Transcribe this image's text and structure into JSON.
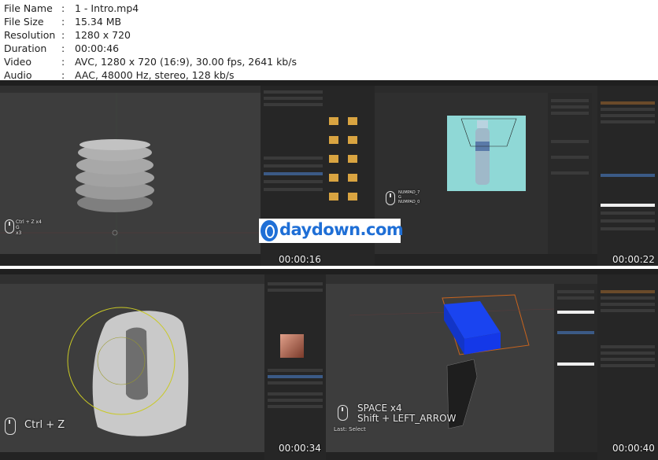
{
  "media_info": [
    {
      "key": "File Name",
      "sep": ":",
      "value": "1 - Intro.mp4"
    },
    {
      "key": "File Size",
      "sep": ":",
      "value": "15.34 MB"
    },
    {
      "key": "Resolution",
      "sep": ":",
      "value": "1280 x 720"
    },
    {
      "key": "Duration",
      "sep": ":",
      "value": "00:00:46"
    },
    {
      "key": "Video",
      "sep": ":",
      "value": "AVC, 1280 x 720 (16:9), 30.00 fps, 2641 kb/s"
    },
    {
      "key": "Audio",
      "sep": ":",
      "value": "AAC, 48000 Hz, stereo, 128 kb/s"
    }
  ],
  "thumbs": {
    "t1": {
      "time": "",
      "overlay": [
        "Ctrl + Z x4",
        "G",
        "x3"
      ]
    },
    "t2": {
      "time": "00:00:16",
      "overlay": [
        "NUMPAD_7",
        "G",
        "NUMPAD_0"
      ]
    },
    "t3": {
      "time": "00:00:22"
    },
    "t4": {
      "time": "00:00:34",
      "overlay": [
        "Ctrl + Z"
      ]
    },
    "t5": {
      "time": "00:00:40",
      "overlay": [
        "SPACE x4",
        "Shift + LEFT_ARROW"
      ],
      "last": "Last: Select"
    }
  },
  "watermark": "daydown.com",
  "colors": {
    "viewport": "#3d3d3d",
    "ui": "#2b2b2b",
    "selected_box": "#1438e8",
    "render_bg": "#8fd8d6"
  }
}
